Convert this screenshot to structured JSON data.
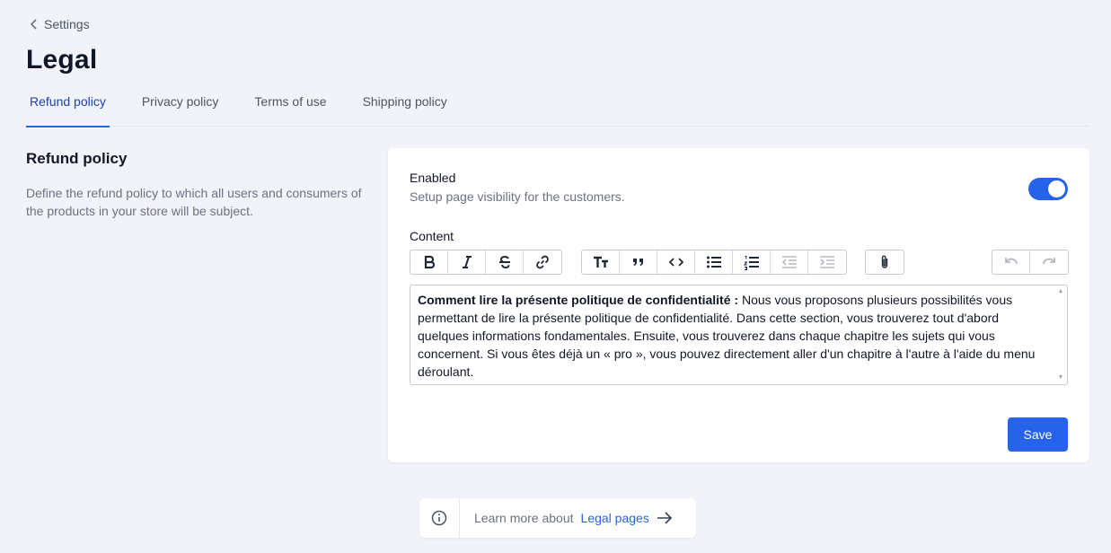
{
  "breadcrumb": {
    "label": "Settings"
  },
  "page": {
    "title": "Legal"
  },
  "tabs": [
    {
      "label": "Refund policy",
      "active": true
    },
    {
      "label": "Privacy policy",
      "active": false
    },
    {
      "label": "Terms of use",
      "active": false
    },
    {
      "label": "Shipping policy",
      "active": false
    }
  ],
  "section": {
    "title": "Refund policy",
    "description": "Define the refund policy to which all users and consumers of the products in your store will be subject."
  },
  "card": {
    "enabled_label": "Enabled",
    "enabled_sub": "Setup page visibility for the customers.",
    "enabled": true,
    "content_label": "Content",
    "editor": {
      "bold_lead": "Comment lire la présente politique de confidentialité :",
      "body": " Nous vous proposons plusieurs possibilités vous permettant de lire la présente politique de confidentialité. Dans cette section, vous trouverez tout d'abord quelques informations fondamentales. Ensuite, vous trouverez dans chaque chapitre les sujets qui vous concernent. Si vous êtes déjà un « pro », vous pouvez directement aller d'un chapitre à l'autre à l'aide du menu déroulant."
    },
    "save_label": "Save"
  },
  "footer": {
    "text": "Learn more about",
    "link": "Legal pages"
  },
  "colors": {
    "accent": "#2563eb",
    "background": "#f1f3f9"
  }
}
